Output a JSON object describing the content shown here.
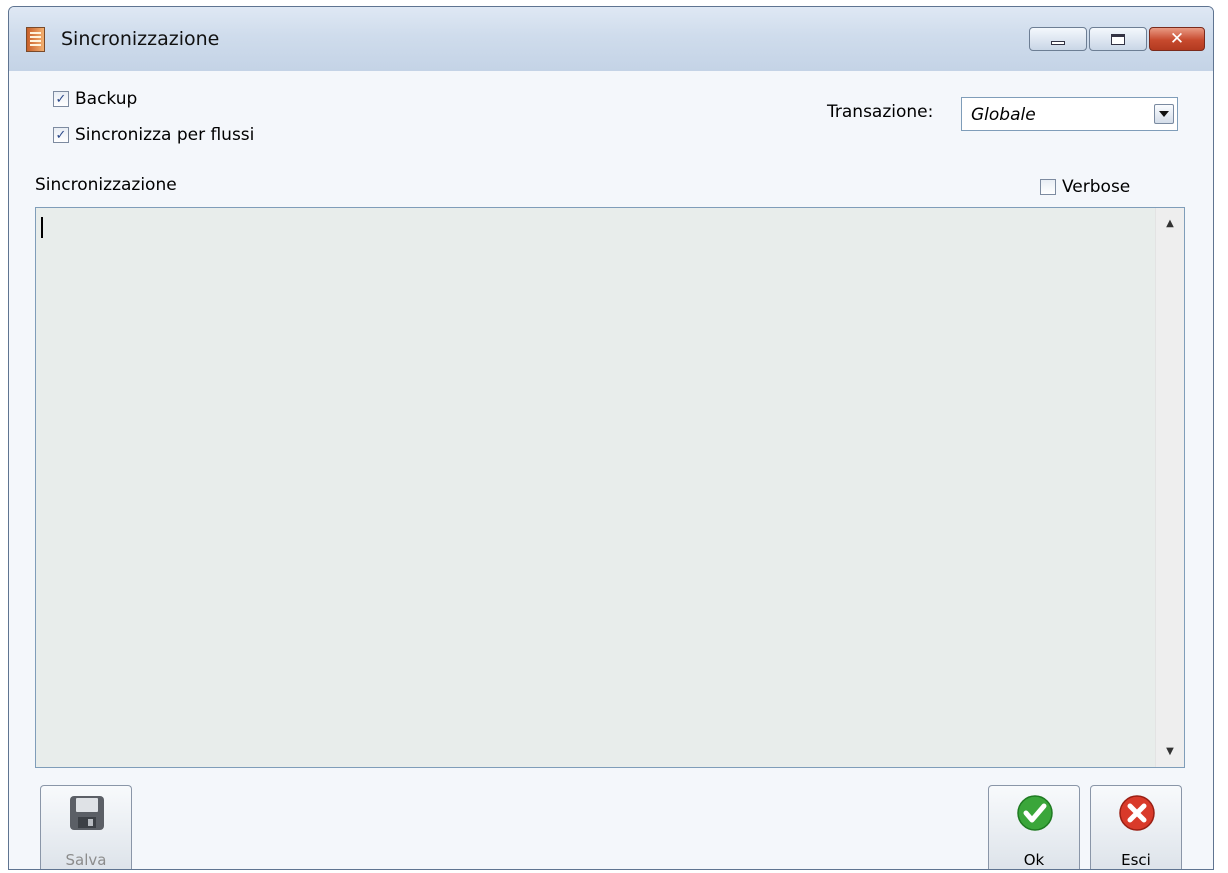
{
  "window": {
    "title": "Sincronizzazione",
    "close_glyph": "✕"
  },
  "options": {
    "backup": {
      "label": "Backup",
      "checked": true,
      "mark": "✓"
    },
    "sync_by_flows": {
      "label": "Sincronizza per flussi",
      "checked": true,
      "mark": "✓"
    },
    "verbose": {
      "label": "Verbose",
      "checked": false,
      "mark": ""
    }
  },
  "transaction": {
    "label": "Transazione:",
    "value": "Globale"
  },
  "log": {
    "section_label": "Sincronizzazione",
    "text": ""
  },
  "buttons": {
    "save": "Salva",
    "ok": "Ok",
    "exit": "Esci"
  },
  "icons": {
    "app": "document-list-icon",
    "save": "floppy-disk-icon",
    "ok": "green-checkmark-icon",
    "exit": "red-x-icon"
  },
  "colors": {
    "ok_green": "#3aa63a",
    "exit_red": "#d93a2a",
    "log_bg": "#e8edeb"
  }
}
